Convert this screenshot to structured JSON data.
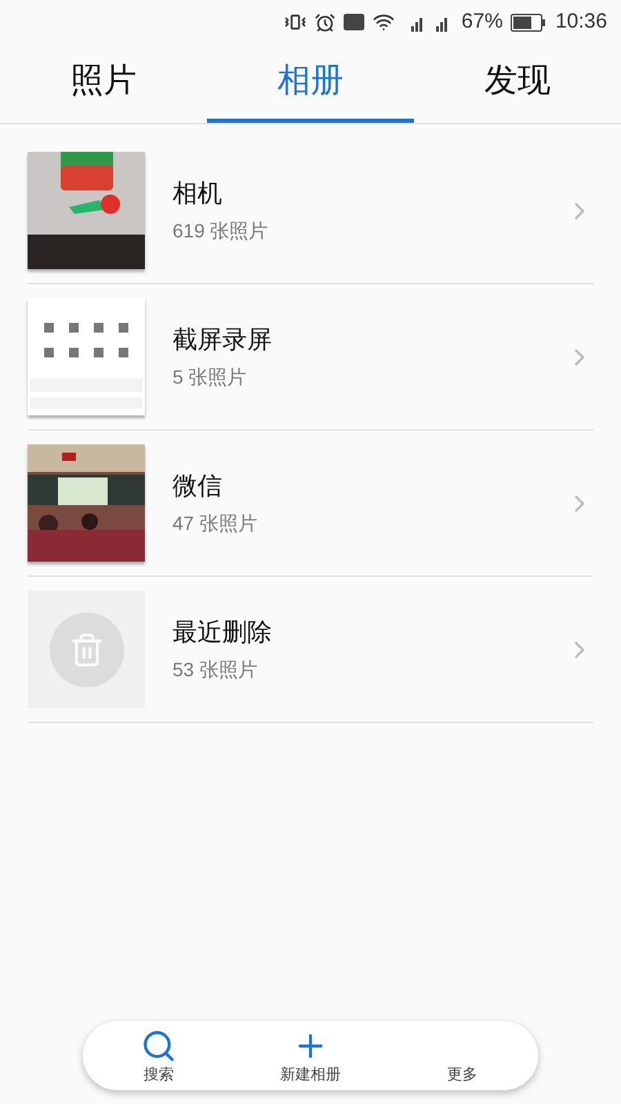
{
  "status_bar": {
    "battery": "67%",
    "time": "10:36"
  },
  "tabs": [
    {
      "label": "照片",
      "selected": false
    },
    {
      "label": "相册",
      "selected": true
    },
    {
      "label": "发现",
      "selected": false
    }
  ],
  "albums": [
    {
      "name": "相机",
      "count": "619 张照片"
    },
    {
      "name": "截屏录屏",
      "count": "5 张照片",
      "kind": "screen"
    },
    {
      "name": "微信",
      "count": "47 张照片",
      "kind": "classroom"
    },
    {
      "name": "最近删除",
      "count": "53 张照片",
      "kind": "trash"
    }
  ],
  "bottom_bar": [
    {
      "label": "搜索",
      "kind": "search"
    },
    {
      "label": "新建相册",
      "kind": "add"
    },
    {
      "label": "更多",
      "kind": "more"
    }
  ]
}
